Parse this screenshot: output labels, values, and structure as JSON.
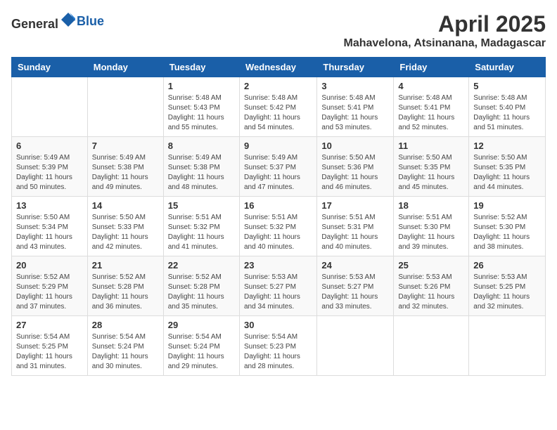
{
  "header": {
    "logo_general": "General",
    "logo_blue": "Blue",
    "month": "April 2025",
    "location": "Mahavelona, Atsinanana, Madagascar"
  },
  "weekdays": [
    "Sunday",
    "Monday",
    "Tuesday",
    "Wednesday",
    "Thursday",
    "Friday",
    "Saturday"
  ],
  "weeks": [
    [
      {
        "day": "",
        "info": ""
      },
      {
        "day": "",
        "info": ""
      },
      {
        "day": "1",
        "info": "Sunrise: 5:48 AM\nSunset: 5:43 PM\nDaylight: 11 hours\nand 55 minutes."
      },
      {
        "day": "2",
        "info": "Sunrise: 5:48 AM\nSunset: 5:42 PM\nDaylight: 11 hours\nand 54 minutes."
      },
      {
        "day": "3",
        "info": "Sunrise: 5:48 AM\nSunset: 5:41 PM\nDaylight: 11 hours\nand 53 minutes."
      },
      {
        "day": "4",
        "info": "Sunrise: 5:48 AM\nSunset: 5:41 PM\nDaylight: 11 hours\nand 52 minutes."
      },
      {
        "day": "5",
        "info": "Sunrise: 5:48 AM\nSunset: 5:40 PM\nDaylight: 11 hours\nand 51 minutes."
      }
    ],
    [
      {
        "day": "6",
        "info": "Sunrise: 5:49 AM\nSunset: 5:39 PM\nDaylight: 11 hours\nand 50 minutes."
      },
      {
        "day": "7",
        "info": "Sunrise: 5:49 AM\nSunset: 5:38 PM\nDaylight: 11 hours\nand 49 minutes."
      },
      {
        "day": "8",
        "info": "Sunrise: 5:49 AM\nSunset: 5:38 PM\nDaylight: 11 hours\nand 48 minutes."
      },
      {
        "day": "9",
        "info": "Sunrise: 5:49 AM\nSunset: 5:37 PM\nDaylight: 11 hours\nand 47 minutes."
      },
      {
        "day": "10",
        "info": "Sunrise: 5:50 AM\nSunset: 5:36 PM\nDaylight: 11 hours\nand 46 minutes."
      },
      {
        "day": "11",
        "info": "Sunrise: 5:50 AM\nSunset: 5:35 PM\nDaylight: 11 hours\nand 45 minutes."
      },
      {
        "day": "12",
        "info": "Sunrise: 5:50 AM\nSunset: 5:35 PM\nDaylight: 11 hours\nand 44 minutes."
      }
    ],
    [
      {
        "day": "13",
        "info": "Sunrise: 5:50 AM\nSunset: 5:34 PM\nDaylight: 11 hours\nand 43 minutes."
      },
      {
        "day": "14",
        "info": "Sunrise: 5:50 AM\nSunset: 5:33 PM\nDaylight: 11 hours\nand 42 minutes."
      },
      {
        "day": "15",
        "info": "Sunrise: 5:51 AM\nSunset: 5:32 PM\nDaylight: 11 hours\nand 41 minutes."
      },
      {
        "day": "16",
        "info": "Sunrise: 5:51 AM\nSunset: 5:32 PM\nDaylight: 11 hours\nand 40 minutes."
      },
      {
        "day": "17",
        "info": "Sunrise: 5:51 AM\nSunset: 5:31 PM\nDaylight: 11 hours\nand 40 minutes."
      },
      {
        "day": "18",
        "info": "Sunrise: 5:51 AM\nSunset: 5:30 PM\nDaylight: 11 hours\nand 39 minutes."
      },
      {
        "day": "19",
        "info": "Sunrise: 5:52 AM\nSunset: 5:30 PM\nDaylight: 11 hours\nand 38 minutes."
      }
    ],
    [
      {
        "day": "20",
        "info": "Sunrise: 5:52 AM\nSunset: 5:29 PM\nDaylight: 11 hours\nand 37 minutes."
      },
      {
        "day": "21",
        "info": "Sunrise: 5:52 AM\nSunset: 5:28 PM\nDaylight: 11 hours\nand 36 minutes."
      },
      {
        "day": "22",
        "info": "Sunrise: 5:52 AM\nSunset: 5:28 PM\nDaylight: 11 hours\nand 35 minutes."
      },
      {
        "day": "23",
        "info": "Sunrise: 5:53 AM\nSunset: 5:27 PM\nDaylight: 11 hours\nand 34 minutes."
      },
      {
        "day": "24",
        "info": "Sunrise: 5:53 AM\nSunset: 5:27 PM\nDaylight: 11 hours\nand 33 minutes."
      },
      {
        "day": "25",
        "info": "Sunrise: 5:53 AM\nSunset: 5:26 PM\nDaylight: 11 hours\nand 32 minutes."
      },
      {
        "day": "26",
        "info": "Sunrise: 5:53 AM\nSunset: 5:25 PM\nDaylight: 11 hours\nand 32 minutes."
      }
    ],
    [
      {
        "day": "27",
        "info": "Sunrise: 5:54 AM\nSunset: 5:25 PM\nDaylight: 11 hours\nand 31 minutes."
      },
      {
        "day": "28",
        "info": "Sunrise: 5:54 AM\nSunset: 5:24 PM\nDaylight: 11 hours\nand 30 minutes."
      },
      {
        "day": "29",
        "info": "Sunrise: 5:54 AM\nSunset: 5:24 PM\nDaylight: 11 hours\nand 29 minutes."
      },
      {
        "day": "30",
        "info": "Sunrise: 5:54 AM\nSunset: 5:23 PM\nDaylight: 11 hours\nand 28 minutes."
      },
      {
        "day": "",
        "info": ""
      },
      {
        "day": "",
        "info": ""
      },
      {
        "day": "",
        "info": ""
      }
    ]
  ]
}
